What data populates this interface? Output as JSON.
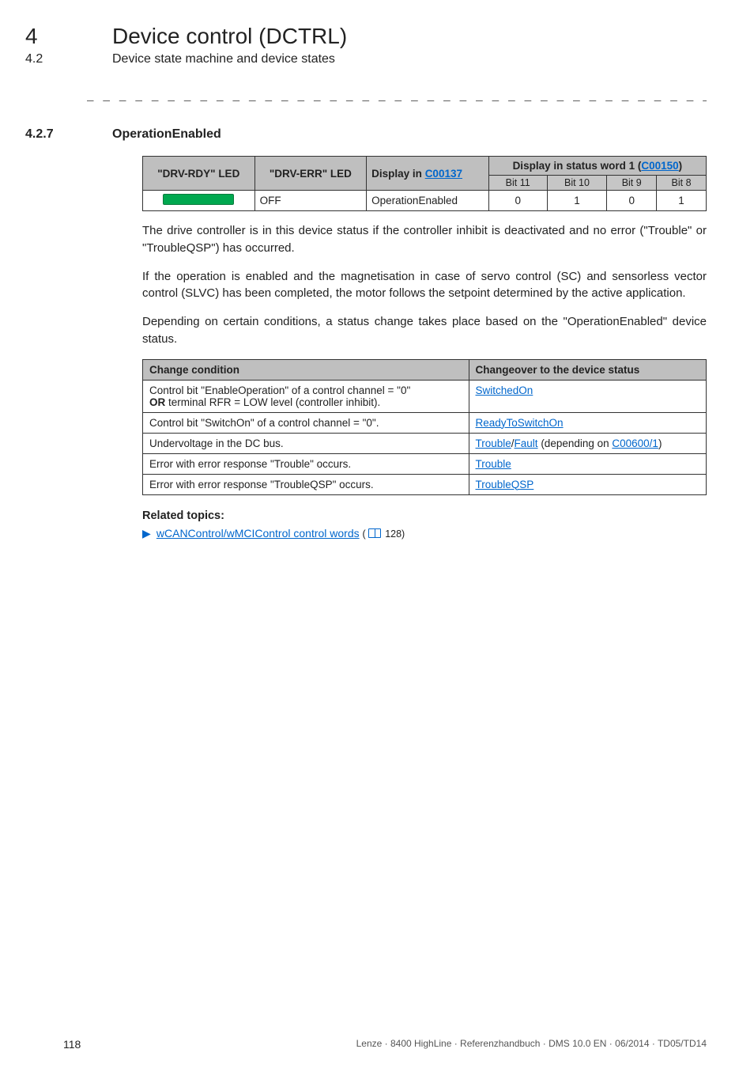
{
  "chapter": {
    "num": "4",
    "title": "Device control (DCTRL)"
  },
  "section": {
    "num": "4.2",
    "title": "Device state machine and device states"
  },
  "separator": "_ _ _ _ _ _ _ _ _ _ _ _ _ _ _ _ _ _ _ _ _ _ _ _ _ _ _ _ _ _ _ _ _ _ _ _ _ _ _ _ _ _ _ _ _ _ _ _ _ _ _ _ _ _ _ _ _ _ _ _ _ _ _ _",
  "subsection": {
    "num": "4.2.7",
    "title": "OperationEnabled"
  },
  "led_table": {
    "headers": {
      "rdy": "\"DRV-RDY\" LED",
      "err": "\"DRV-ERR\" LED",
      "display_prefix": "Display in ",
      "display_link": "C00137",
      "status_prefix": "Display in status word 1 (",
      "status_link": "C00150",
      "status_suffix": ")"
    },
    "subheaders": [
      "Bit 11",
      "Bit 10",
      "Bit 9",
      "Bit 8"
    ],
    "row": {
      "err": "OFF",
      "display": "OperationEnabled",
      "bits": [
        "0",
        "1",
        "0",
        "1"
      ]
    }
  },
  "paragraphs": {
    "p1": "The drive controller is in this device status if the controller inhibit is deactivated and no error (\"Trouble\" or \"TroubleQSP\") has occurred.",
    "p2": "If the operation is enabled and the magnetisation in case of servo control (SC) and sensorless vector control (SLVC) has been completed, the motor follows the setpoint determined by the active application.",
    "p3": "Depending on certain conditions, a status change takes place based on the \"OperationEnabled\" device status."
  },
  "cond_table": {
    "headers": {
      "c1": "Change condition",
      "c2": "Changeover to the device status"
    },
    "rows": [
      {
        "cond_lines": [
          "Control bit \"EnableOperation\" of a control channel = \"0\"",
          "OR terminal RFR = LOW level (controller inhibit)."
        ],
        "cond_bold_prefix": "OR",
        "status_parts": [
          {
            "text": "SwitchedOn",
            "link": true
          }
        ]
      },
      {
        "cond_lines": [
          "Control bit \"SwitchOn\" of a control channel = \"0\"."
        ],
        "status_parts": [
          {
            "text": "ReadyToSwitchOn",
            "link": true
          }
        ]
      },
      {
        "cond_lines": [
          "Undervoltage in the DC bus."
        ],
        "status_parts": [
          {
            "text": "Trouble",
            "link": true
          },
          {
            "text": "/",
            "link": false
          },
          {
            "text": "Fault",
            "link": true
          },
          {
            "text": " (depending on ",
            "link": false
          },
          {
            "text": "C00600/1",
            "link": true
          },
          {
            "text": ")",
            "link": false
          }
        ]
      },
      {
        "cond_lines": [
          "Error with error response \"Trouble\" occurs."
        ],
        "status_parts": [
          {
            "text": "Trouble",
            "link": true
          }
        ]
      },
      {
        "cond_lines": [
          "Error with error response \"TroubleQSP\" occurs."
        ],
        "status_parts": [
          {
            "text": "TroubleQSP",
            "link": true
          }
        ]
      }
    ]
  },
  "related": {
    "heading": "Related topics:",
    "item_text": "wCANControl/wMCIControl control words",
    "page_ref": "128"
  },
  "footer": {
    "page": "118",
    "info": "Lenze · 8400 HighLine · Referenzhandbuch · DMS 10.0 EN · 06/2014 · TD05/TD14"
  }
}
